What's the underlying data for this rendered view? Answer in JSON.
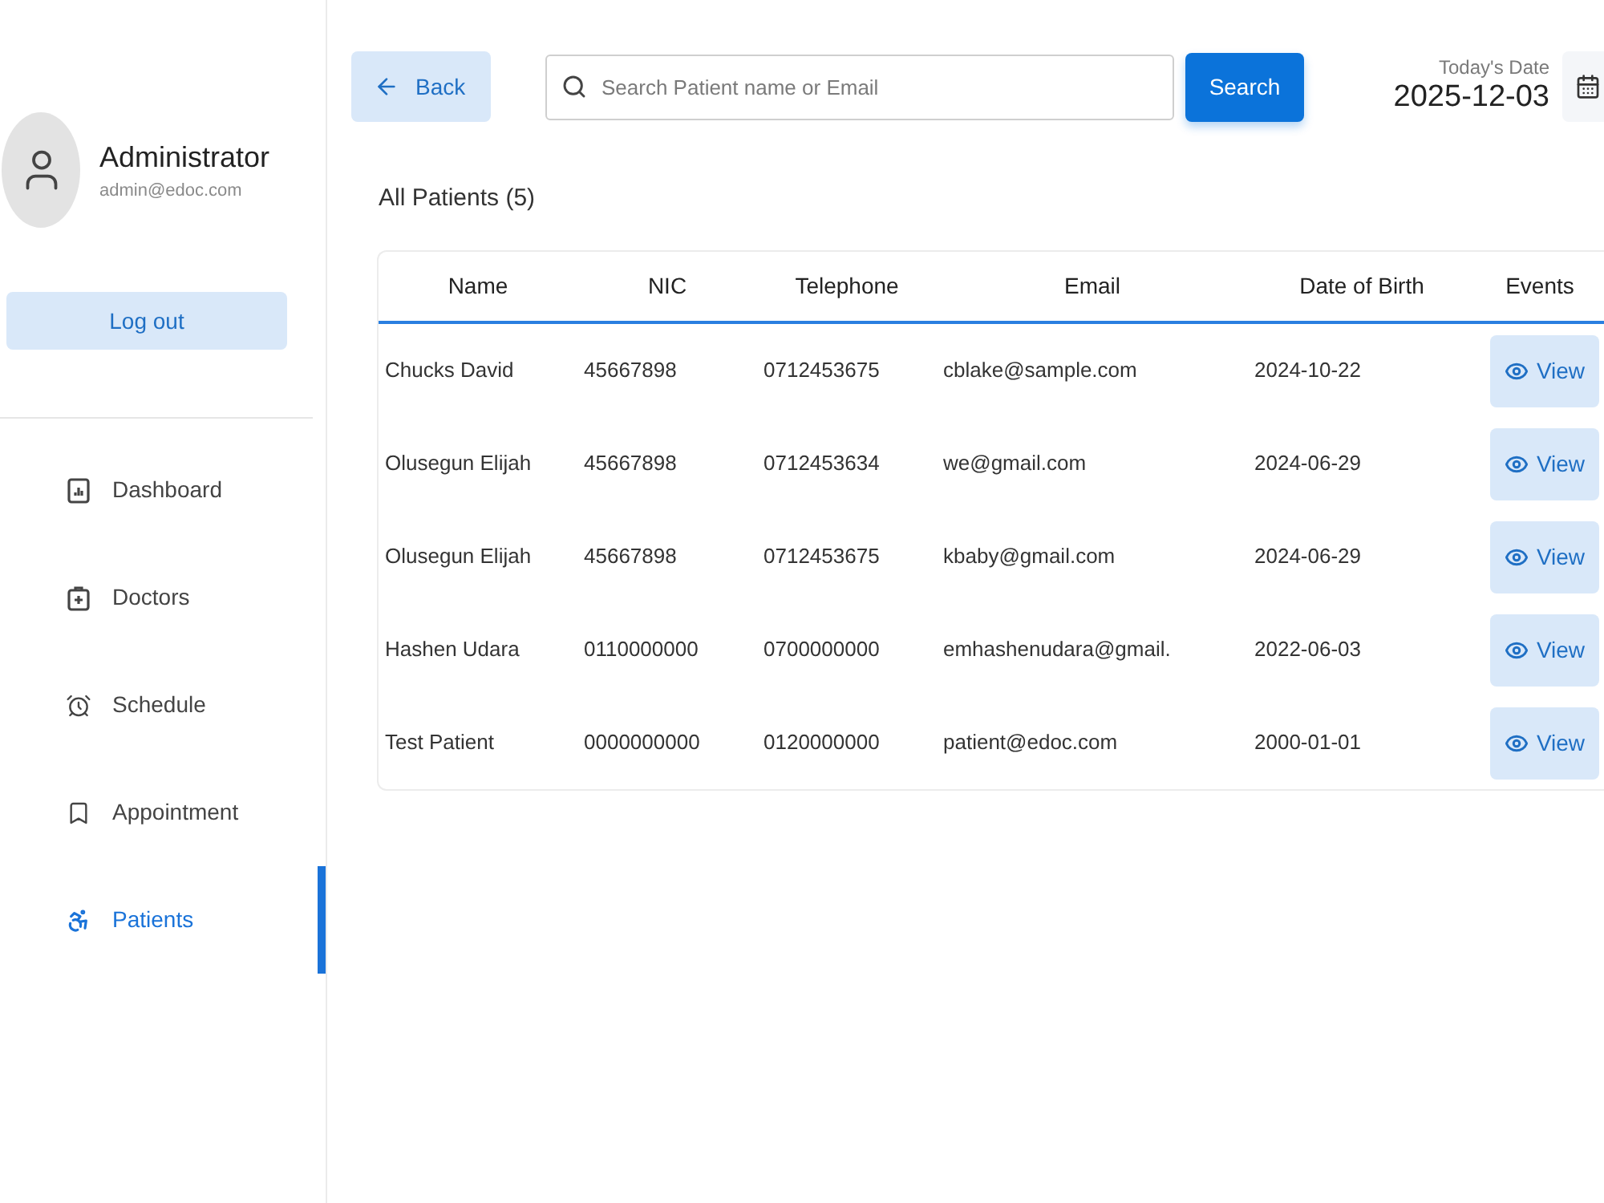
{
  "profile": {
    "name": "Administrator",
    "email": "admin@edoc.com"
  },
  "logout_button": "Log out",
  "nav": [
    {
      "label": "Dashboard",
      "selected": false
    },
    {
      "label": "Doctors",
      "selected": false
    },
    {
      "label": "Schedule",
      "selected": false
    },
    {
      "label": "Appointment",
      "selected": false
    },
    {
      "label": "Patients",
      "selected": true
    }
  ],
  "toolbar": {
    "back_button": "Back",
    "search": {
      "placeholder": "Search Patient name or Email"
    },
    "search_button": "Search",
    "date_label": "Today's Date",
    "date": "2025-12-03"
  },
  "patients": {
    "title": "All Patients (5)",
    "columns": [
      "Name",
      "NIC",
      "Telephone",
      "Email",
      "Date of Birth",
      "Events"
    ],
    "rows": [
      {
        "name": "Chucks David",
        "nic": "45667898",
        "telephone": "0712453675",
        "email": "cblake@sample.com",
        "date_of_birth": "2024-10-22",
        "action": "View"
      },
      {
        "name": "Olusegun Elijah",
        "nic": "45667898",
        "telephone": "0712453634",
        "email": "we@gmail.com",
        "date_of_birth": "2024-06-29",
        "action": "View"
      },
      {
        "name": "Olusegun Elijah",
        "nic": "45667898",
        "telephone": "0712453675",
        "email": "kbaby@gmail.com",
        "date_of_birth": "2024-06-29",
        "action": "View"
      },
      {
        "name": "Hashen Udara",
        "nic": "0110000000",
        "telephone": "0700000000",
        "email": "emhashenudara@gmail.",
        "date_of_birth": "2022-06-03",
        "action": "View"
      },
      {
        "name": "Test Patient",
        "nic": "0000000000",
        "telephone": "0120000000",
        "email": "patient@edoc.com",
        "date_of_birth": "2000-01-01",
        "action": "View"
      }
    ]
  }
}
